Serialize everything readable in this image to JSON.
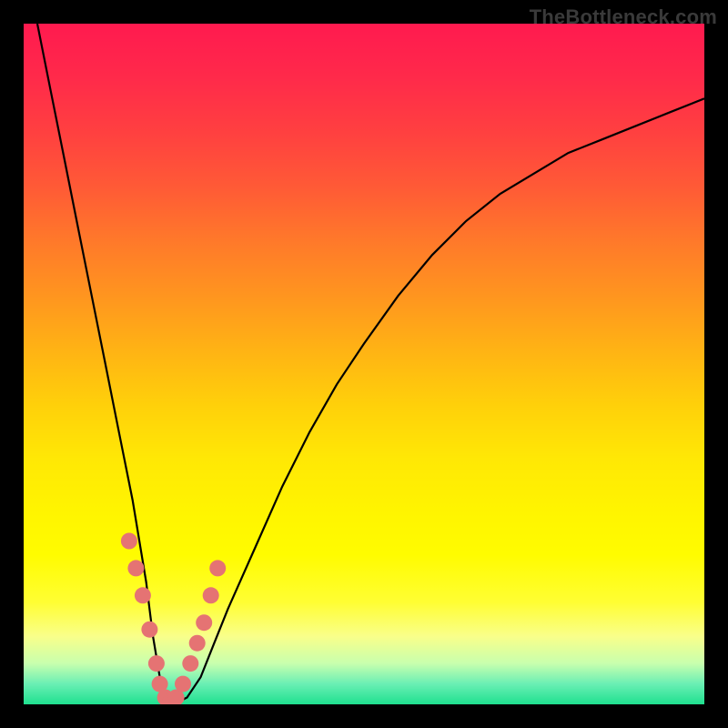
{
  "watermark": "TheBottleneck.com",
  "chart_data": {
    "type": "line",
    "title": "",
    "xlabel": "",
    "ylabel": "",
    "xlim": [
      0,
      100
    ],
    "ylim": [
      0,
      100
    ],
    "grid": false,
    "legend": false,
    "series": [
      {
        "name": "curve",
        "x": [
          2,
          4,
          6,
          8,
          10,
          12,
          14,
          16,
          18,
          19,
          20,
          21,
          22,
          24,
          26,
          28,
          30,
          34,
          38,
          42,
          46,
          50,
          55,
          60,
          65,
          70,
          75,
          80,
          85,
          90,
          95,
          100
        ],
        "y": [
          100,
          90,
          80,
          70,
          60,
          50,
          40,
          30,
          18,
          10,
          4,
          1,
          0,
          1,
          4,
          9,
          14,
          23,
          32,
          40,
          47,
          53,
          60,
          66,
          71,
          75,
          78,
          81,
          83,
          85,
          87,
          89
        ]
      }
    ],
    "markers": {
      "name": "highlight-dots",
      "x": [
        15.5,
        16.5,
        17.5,
        18.5,
        19.5,
        20.0,
        20.8,
        21.6,
        22.4,
        23.4,
        24.5,
        25.5,
        26.5,
        27.5,
        28.5
      ],
      "y": [
        24,
        20,
        16,
        11,
        6,
        3,
        1,
        0.5,
        1,
        3,
        6,
        9,
        12,
        16,
        20
      ]
    },
    "background_gradient": {
      "top": "#ff1a4f",
      "mid": "#fff500",
      "bottom": "#1fe08f"
    }
  }
}
